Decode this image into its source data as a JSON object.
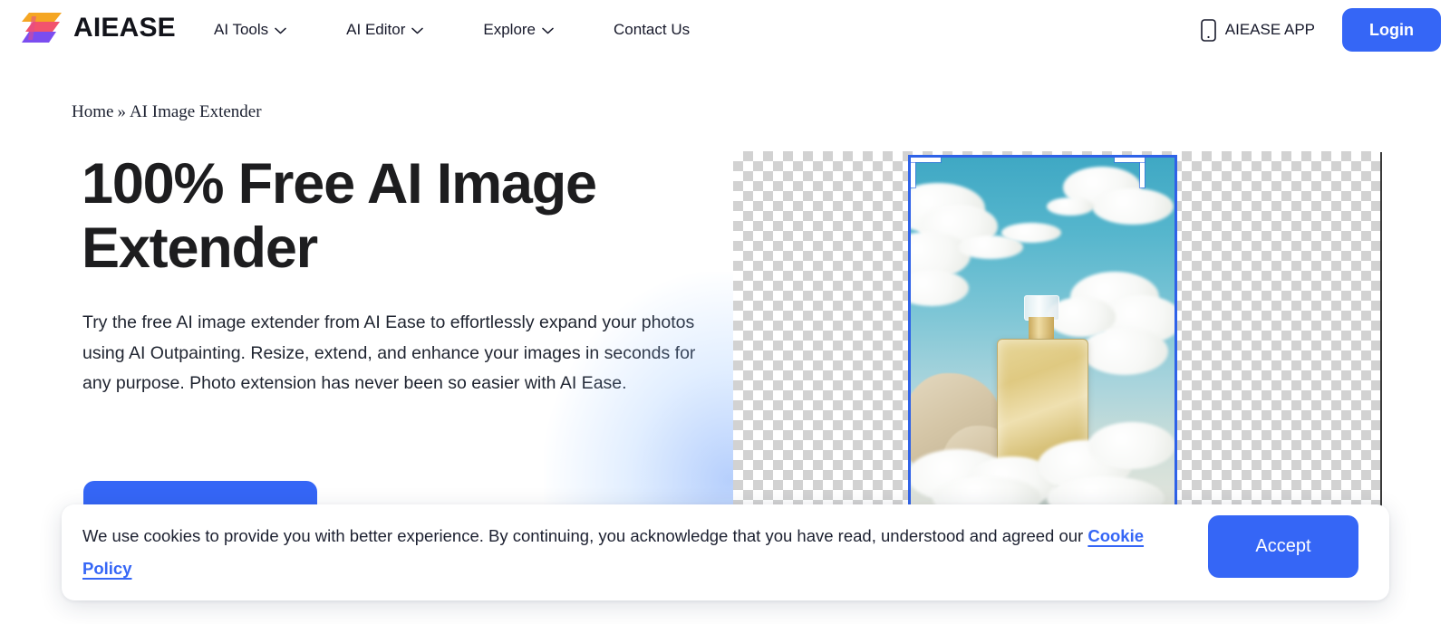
{
  "brand": {
    "name": "AIEASE",
    "logo_colors": [
      "#F5A623",
      "#F2536D",
      "#7B4DF0"
    ]
  },
  "header": {
    "nav_items": [
      {
        "label": "AI Tools",
        "has_dropdown": true,
        "icon": "chevron-down-icon"
      },
      {
        "label": "AI Editor",
        "has_dropdown": true,
        "icon": "chevron-down-icon"
      },
      {
        "label": "Explore",
        "has_dropdown": true,
        "icon": "chevron-down-icon"
      },
      {
        "label": "Contact Us",
        "has_dropdown": false,
        "icon": ""
      }
    ],
    "app_link": {
      "label": "AIEASE APP",
      "icon": "mobile-phone-icon"
    },
    "login_label": "Login"
  },
  "breadcrumb": {
    "home": "Home",
    "separator": "»",
    "current": "AI Image Extender"
  },
  "hero": {
    "title": "100% Free AI Image Extender",
    "description": "Try the free AI image extender from AI Ease to effortlessly expand your photos using AI Outpainting. Resize, extend, and enhance your images in seconds for any purpose. Photo extension has never been so easier with AI Ease.",
    "cta_label": ""
  },
  "canvas": {
    "transparency_checkerboard": true,
    "selection_frame_color": "#2F62E8",
    "image_description": "Perfume bottle on clouds against blue sky"
  },
  "cookie_banner": {
    "text_before_link": "We use cookies to provide you with better experience. By continuing, you acknowledge that you have read, understood and agreed our ",
    "link_label": "Cookie Policy",
    "accept_label": "Accept"
  },
  "colors": {
    "accent": "#3566F6",
    "text": "#1C2030",
    "frame": "#2F62E8"
  }
}
